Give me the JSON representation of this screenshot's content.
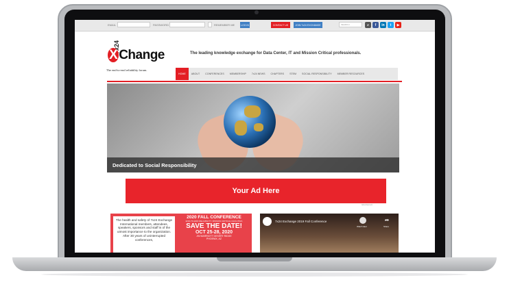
{
  "topbar": {
    "email_label": "EMAIL",
    "password_label": "PASSWORD",
    "remember_label": "REMEMBER ME",
    "login_button": "LOG IN",
    "contact_button": "CONTACT US",
    "join_button": "JOIN 7x24 EXCHANGE",
    "search_placeholder": "SEARCH",
    "social": [
      "search-icon",
      "facebook-icon",
      "linkedin-icon",
      "twitter-icon",
      "youtube-icon"
    ]
  },
  "header": {
    "logo_top": "7x24",
    "logo_x": "X",
    "logo_main": "Change",
    "logo_sub": "The end-to-end reliability forum.",
    "tagline": "The leading knowledge exchange for Data Center, IT and Mission Critical professionals."
  },
  "nav": {
    "items": [
      "HOME",
      "ABOUT",
      "CONFERENCES",
      "MEMBERSHIP",
      "7x24 NEWS",
      "CHAPTERS",
      "STEM",
      "SOCIAL RESPONSIBILITY",
      "MEMBER RESOURCES"
    ]
  },
  "hero": {
    "caption": "Dedicated to Social Responsibility"
  },
  "ad": {
    "label": "Your Ad Here",
    "note": "Advertisement"
  },
  "promo": {
    "body": "The health and safety of 7x24 Exchange International members, attendees, speakers, sponsors and staff is of the utmost importance to the organization. After 30 years of uninterrupted conferences,",
    "title": "2020 FALL CONFERENCE",
    "subtitle": "END-TO-END RELIABILITY: MISSION CRITICAL FACILITIES",
    "save": "SAVE THE DATE!",
    "dates": "OCT 25-28, 2020",
    "venue": "JW MARRIOTT DESERT RIDGE",
    "city": "PHOENIX, AZ"
  },
  "video": {
    "title": "7x24 Exchange 2019 Fall Conference",
    "watch_later": "Watch later",
    "share": "Share"
  },
  "colors": {
    "brand_red": "#e31e24",
    "nav_bg": "#e8e8e8"
  }
}
